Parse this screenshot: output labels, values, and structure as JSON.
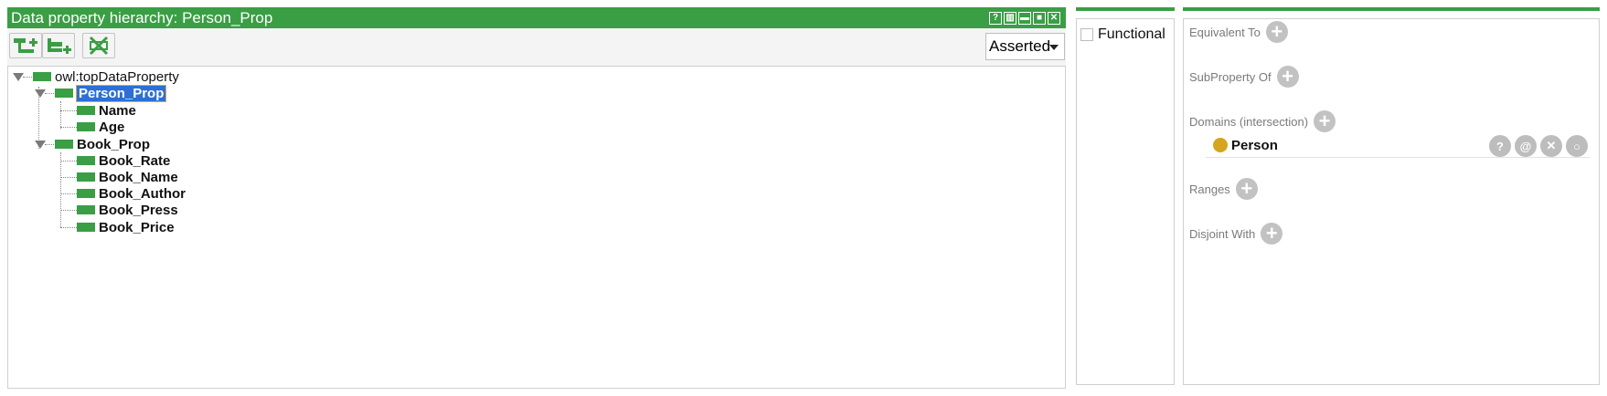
{
  "left_panel": {
    "title": "Data property hierarchy: Person_Prop",
    "window_buttons": [
      {
        "icon": "help-icon",
        "glyph": "?"
      },
      {
        "icon": "split-vertical-icon",
        "glyph": "▥"
      },
      {
        "icon": "minimize-icon",
        "glyph": "▬"
      },
      {
        "icon": "maximize-icon",
        "glyph": "■"
      },
      {
        "icon": "close-icon",
        "glyph": "✕"
      }
    ],
    "toolbar": {
      "add_subproperty_icon": "add-subproperty-icon",
      "add_sibling_icon": "add-sibling-icon",
      "delete_icon": "delete-property-icon"
    },
    "view_mode": {
      "selected": "Asserted"
    },
    "tree": {
      "root": "owl:topDataProperty",
      "person_prop": "Person_Prop",
      "name": "Name",
      "age": "Age",
      "book_prop": "Book_Prop",
      "book_rate": "Book_Rate",
      "book_name": "Book_Name",
      "book_author": "Book_Author",
      "book_press": "Book_Press",
      "book_price": "Book_Price"
    }
  },
  "characteristics": {
    "functional_label": "Functional",
    "functional_checked": false
  },
  "description": {
    "equivalent_to": "Equivalent To",
    "subproperty_of": "SubProperty Of",
    "domains": "Domains (intersection)",
    "domain_item": "Person",
    "domain_actions": [
      "?",
      "@",
      "✕",
      "○"
    ],
    "ranges": "Ranges",
    "disjoint_with": "Disjoint With"
  },
  "colors": {
    "accent": "#3a9e44",
    "selection": "#2d6fd4",
    "class_dot": "#d6a51f"
  }
}
